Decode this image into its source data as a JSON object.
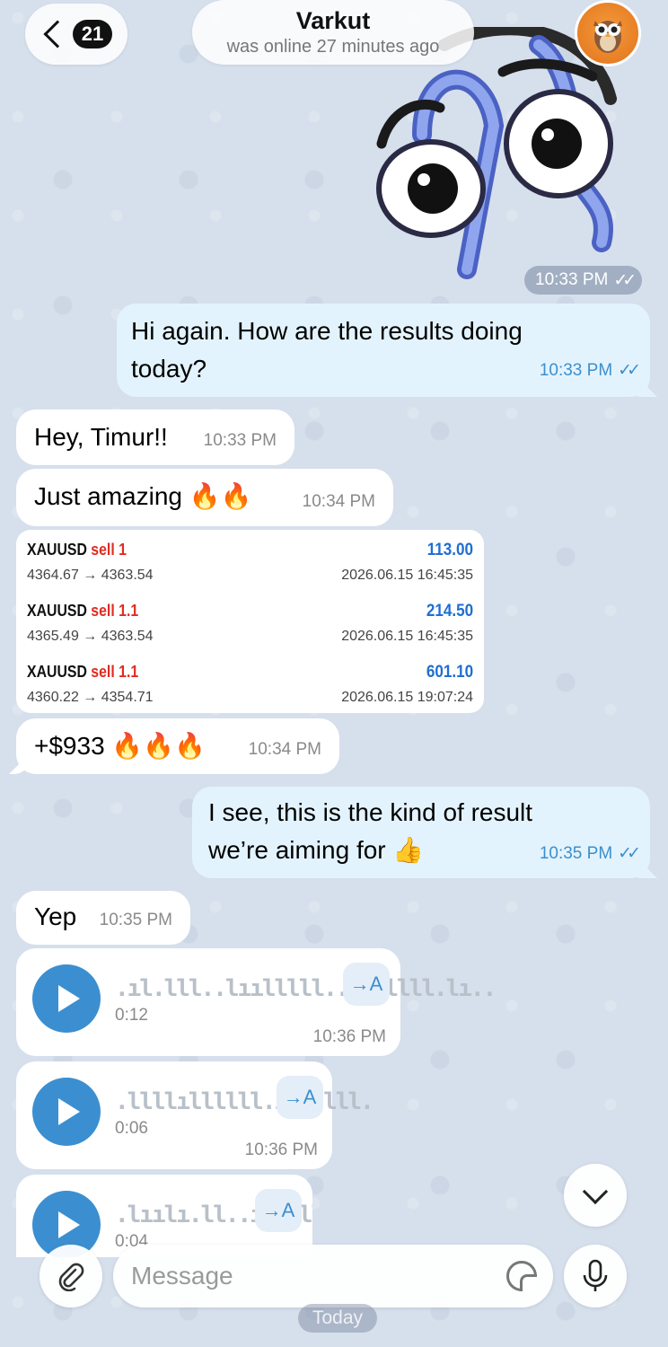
{
  "header": {
    "back_count": "21",
    "chat_name": "Varkut",
    "status": "was online 27 minutes ago"
  },
  "messages": {
    "sticker_time": "10:33 PM",
    "m1": {
      "text": "Hi again. How are the results doing today?",
      "line1": "Hi again. How are the results doing",
      "line2": "today?",
      "time": "10:33 PM"
    },
    "m2": {
      "text": "Hey, Timur!!",
      "time": "10:33 PM"
    },
    "m3": {
      "text": "Just amazing 🔥🔥",
      "time": "10:34 PM"
    },
    "trades": [
      {
        "symbol": "XAUUSD",
        "side": "sell 1",
        "prices": "4364.67 → 4363.54",
        "profit": "113.00",
        "date": "2026.06.15 16:45:35"
      },
      {
        "symbol": "XAUUSD",
        "side": "sell 1.1",
        "prices": "4365.49 → 4363.54",
        "profit": "214.50",
        "date": "2026.06.15 16:45:35"
      },
      {
        "symbol": "XAUUSD",
        "side": "sell 1.1",
        "prices": "4360.22 → 4354.71",
        "profit": "601.10",
        "date": "2026.06.15 19:07:24"
      }
    ],
    "m4": {
      "text": "+$933 🔥🔥🔥",
      "time": "10:34 PM"
    },
    "m5": {
      "line1": "I see, this is the kind of result",
      "line2": "we’re aiming for 👍",
      "time": "10:35 PM"
    },
    "m6": {
      "text": "Yep",
      "time": "10:35 PM"
    },
    "voice": [
      {
        "wave": ".ıl.lll..lıılllll....lllll.lı..",
        "duration": "0:12",
        "time": "10:36 PM",
        "translate": "→A"
      },
      {
        "wave": ".llllıllllll.ıl..lll.",
        "duration": "0:06",
        "time": "10:36 PM",
        "translate": "→A"
      },
      {
        "wave": ".lıılı.ll..ıllllll",
        "duration": "0:04",
        "translate": "→A"
      }
    ]
  },
  "composer": {
    "placeholder": "Message"
  },
  "date_badge": "Today",
  "icons": [
    "back-chevron-icon",
    "owl-avatar-icon",
    "double-check-icon",
    "play-icon",
    "chevron-down-icon",
    "paperclip-icon",
    "sticker-icon",
    "microphone-icon"
  ],
  "colors": {
    "accent": "#3b8fd0",
    "outgoing_bubble": "#e3f3fd",
    "sell_red": "#e02b20",
    "profit_blue": "#1f6fd0"
  }
}
